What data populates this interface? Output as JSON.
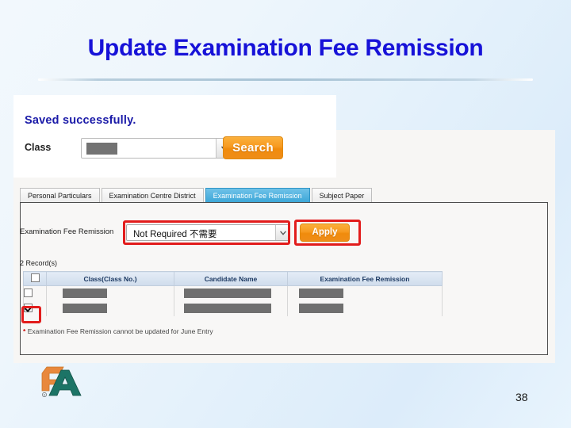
{
  "slide": {
    "title": "Update Examination Fee Remission",
    "page_number": "38",
    "title_color": "#1712d8"
  },
  "app": {
    "saved_message": "Saved successfully.",
    "search_bar": {
      "class_label": "Class",
      "class_value": "",
      "search_button": "Search",
      "dropdown_icon": "chevron-down-icon"
    },
    "tabs": [
      {
        "label": "Personal Particulars",
        "active": false
      },
      {
        "label": "Examination Centre District",
        "active": false
      },
      {
        "label": "Examination Fee Remission",
        "active": true
      },
      {
        "label": "Subject Paper",
        "active": false
      }
    ],
    "remission_form": {
      "label": "Examination Fee Remission",
      "selected_value": "Not Required 不需要",
      "dropdown_icon": "chevron-down-icon",
      "apply_button": "Apply"
    },
    "record_count": "2  Record(s)",
    "table": {
      "headers": [
        "",
        "Class(Class No.)",
        "Candidate Name",
        "Examination Fee Remission"
      ],
      "select_all_checked": false,
      "rows": [
        {
          "checked": false,
          "class_no": "",
          "candidate_name": "",
          "remission": ""
        },
        {
          "checked": true,
          "class_no": "",
          "candidate_name": "",
          "remission": ""
        }
      ]
    },
    "footnote_star": "*",
    "footnote": "Examination Fee Remission cannot be updated for June Entry",
    "highlight_color": "#e21c1c",
    "accent_orange": "#f79a20",
    "active_tab_blue": "#3da7d8"
  },
  "logo": {
    "name": "hkeaa-logo",
    "orange": "#e8883c",
    "teal": "#1c7466"
  }
}
